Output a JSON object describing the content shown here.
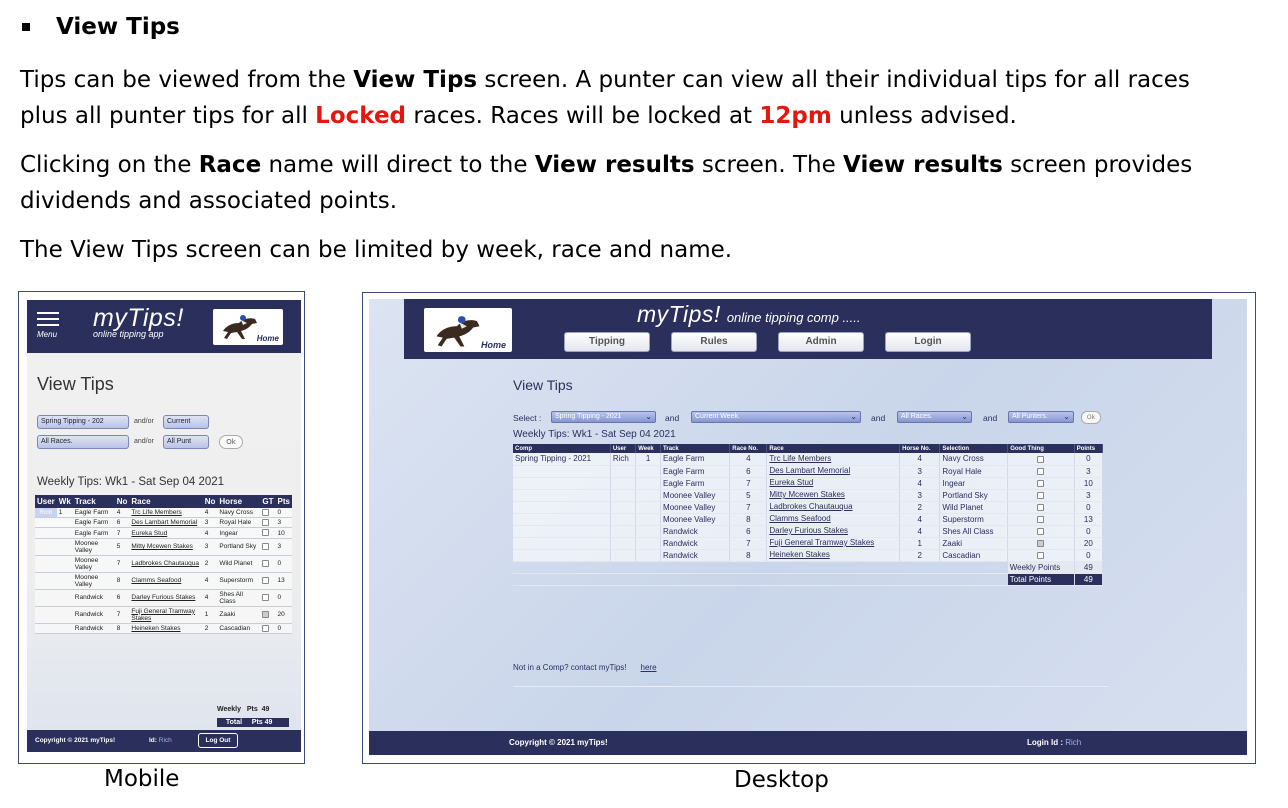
{
  "doc": {
    "heading": "View Tips",
    "p1_a": "Tips can be viewed from the ",
    "p1_b": "View Tips",
    "p1_c": " screen. A punter can view all their individual tips for all races",
    "p1_d": "plus all punter tips for all ",
    "p1_e": "Locked",
    "p1_f": " races.  Races will be locked at ",
    "p1_g": "12pm",
    "p1_h": " unless advised.",
    "p2_a": "Clicking on the ",
    "p2_b": "Race",
    "p2_c": " name will direct to the ",
    "p2_d": "View results",
    "p2_e": " screen. The ",
    "p2_f": "View results",
    "p2_g": " screen provides",
    "p2_h": "dividends and associated points.",
    "p3": "The View Tips screen can be limited by week, race and name.",
    "caption_mobile": "Mobile",
    "caption_desktop": "Desktop"
  },
  "mobile": {
    "menu_label": "Menu",
    "brand": "myTips!",
    "brand_sub": "online tipping app",
    "home": "Home",
    "title": "View Tips",
    "sel_comp": "Spring Tipping - 202",
    "andor1": "and/or",
    "sel_week": "Current",
    "sel_race": "All Races.",
    "andor2": "and/or",
    "sel_punt": "All Punt",
    "ok": "Ok",
    "weekly": "Weekly Tips: Wk1 - Sat Sep 04 2021",
    "headers": [
      "User",
      "Wk",
      "Track",
      "No",
      "Race",
      "No",
      "Horse",
      "GT",
      "Pts"
    ],
    "rows": [
      {
        "user": "Rich",
        "wk": "1",
        "track": "Eagle Farm",
        "no": "4",
        "race": "Trc Life Members",
        "hno": "4",
        "horse": "Navy Cross",
        "pts": "0"
      },
      {
        "user": "",
        "wk": "",
        "track": "Eagle Farm",
        "no": "6",
        "race": "Des Lambart Memorial",
        "hno": "3",
        "horse": "Royal Hale",
        "pts": "3"
      },
      {
        "user": "",
        "wk": "",
        "track": "Eagle Farm",
        "no": "7",
        "race": "Eureka Stud",
        "hno": "4",
        "horse": "Ingear",
        "pts": "10"
      },
      {
        "user": "",
        "wk": "",
        "track": "Moonee Valley",
        "no": "5",
        "race": "Mitty Mcewen Stakes",
        "hno": "3",
        "horse": "Portland Sky",
        "pts": "3"
      },
      {
        "user": "",
        "wk": "",
        "track": "Moonee Valley",
        "no": "7",
        "race": "Ladbrokes Chautauqua",
        "hno": "2",
        "horse": "Wild Planet",
        "pts": "0"
      },
      {
        "user": "",
        "wk": "",
        "track": "Moonee Valley",
        "no": "8",
        "race": "Clamms Seafood",
        "hno": "4",
        "horse": "Superstorm",
        "pts": "13"
      },
      {
        "user": "",
        "wk": "",
        "track": "Randwick",
        "no": "6",
        "race": "Darley Furious Stakes",
        "hno": "4",
        "horse": "Shes All Class",
        "pts": "0"
      },
      {
        "user": "",
        "wk": "",
        "track": "Randwick",
        "no": "7",
        "race": "Fuji General Tramway Stakes",
        "hno": "1",
        "horse": "Zaaki",
        "pts": "20"
      },
      {
        "user": "",
        "wk": "",
        "track": "Randwick",
        "no": "8",
        "race": "Heineken Stakes",
        "hno": "2",
        "horse": "Cascadian",
        "pts": "0"
      }
    ],
    "weekly_label": "Weekly",
    "pts_label": "Pts",
    "weekly_pts": "49",
    "total_label": "Total",
    "total_pts": "49",
    "copyright": "Copyright © 2021 myTips!",
    "id_label": "Id:",
    "id_value": "Rich",
    "logout": "Log Out"
  },
  "desktop": {
    "home": "Home",
    "brand": "myTips!",
    "brand_sub": "online tipping comp .....",
    "nav": [
      "Tipping",
      "Rules",
      "Admin",
      "Login"
    ],
    "title": "View Tips",
    "select_label": "Select :",
    "sel_comp": "Spring Tipping - 2021",
    "and": "and",
    "sel_week": "Current Week.",
    "sel_race": "All Races.",
    "sel_punt": "All Punters.",
    "ok": "Ok",
    "weekly": "Weekly Tips: Wk1 - Sat Sep 04 2021",
    "headers": [
      "Comp",
      "User",
      "Week",
      "Track",
      "Race No.",
      "Race",
      "Horse No.",
      "Selection",
      "Good Thing",
      "Points"
    ],
    "comp": "Spring Tipping - 2021",
    "user": "Rich",
    "week": "1",
    "rows": [
      {
        "track": "Eagle Farm",
        "rno": "4",
        "race": "Trc Life Members",
        "hno": "4",
        "sel": "Navy Cross",
        "gt": false,
        "pts": "0"
      },
      {
        "track": "Eagle Farm",
        "rno": "6",
        "race": "Des Lambart Memorial",
        "hno": "3",
        "sel": "Royal Hale",
        "gt": false,
        "pts": "3"
      },
      {
        "track": "Eagle Farm",
        "rno": "7",
        "race": "Eureka Stud",
        "hno": "4",
        "sel": "Ingear",
        "gt": false,
        "pts": "10"
      },
      {
        "track": "Moonee Valley",
        "rno": "5",
        "race": "Mitty Mcewen Stakes",
        "hno": "3",
        "sel": "Portland Sky",
        "gt": false,
        "pts": "3"
      },
      {
        "track": "Moonee Valley",
        "rno": "7",
        "race": "Ladbrokes Chautauqua",
        "hno": "2",
        "sel": "Wild Planet",
        "gt": false,
        "pts": "0"
      },
      {
        "track": "Moonee Valley",
        "rno": "8",
        "race": "Clamms Seafood",
        "hno": "4",
        "sel": "Superstorm",
        "gt": false,
        "pts": "13"
      },
      {
        "track": "Randwick",
        "rno": "6",
        "race": "Darley Furious Stakes",
        "hno": "4",
        "sel": "Shes All Class",
        "gt": false,
        "pts": "0"
      },
      {
        "track": "Randwick",
        "rno": "7",
        "race": "Fuji General Tramway Stakes",
        "hno": "1",
        "sel": "Zaaki",
        "gt": true,
        "pts": "20"
      },
      {
        "track": "Randwick",
        "rno": "8",
        "race": "Heineken Stakes",
        "hno": "2",
        "sel": "Cascadian",
        "gt": false,
        "pts": "0"
      }
    ],
    "weekly_points_label": "Weekly Points",
    "weekly_points": "49",
    "total_points_label": "Total Points",
    "total_points": "49",
    "not_in_comp": "Not in a Comp? contact myTips!",
    "here": "here",
    "copyright": "Copyright © 2021 myTips!",
    "login_id_label": "Login Id :",
    "login_id": "Rich"
  },
  "colors": {
    "navy": "#2a2f5b",
    "red_highlight": "#e3170d",
    "link_blue": "#9fb4ea"
  }
}
